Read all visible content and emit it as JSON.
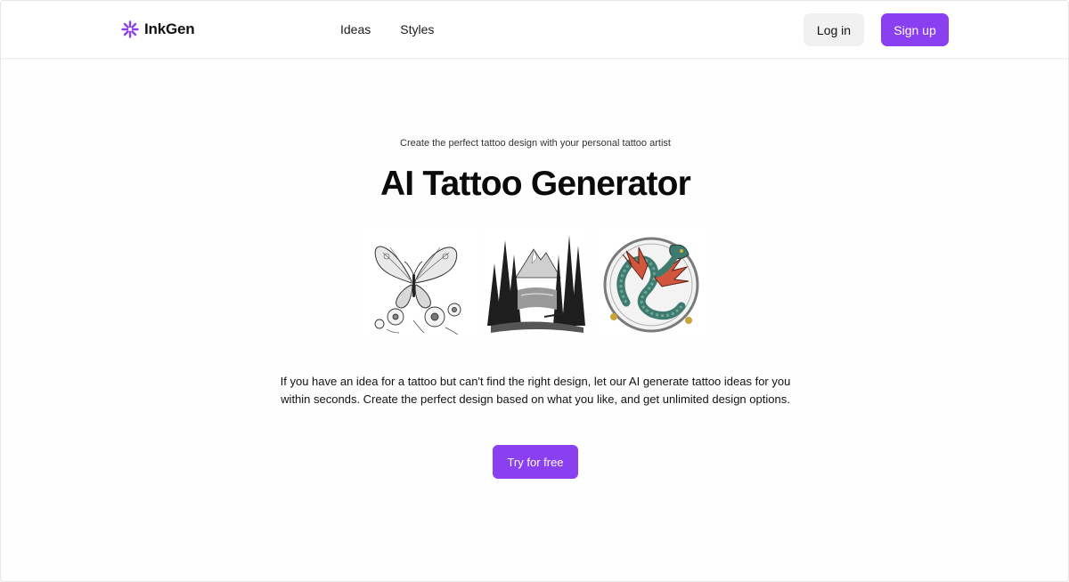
{
  "brand": {
    "name": "InkGen",
    "icon": "sparkle-logo-icon",
    "color": "#8a3ff0"
  },
  "nav": {
    "items": [
      {
        "label": "Ideas"
      },
      {
        "label": "Styles"
      }
    ]
  },
  "header": {
    "login_label": "Log in",
    "signup_label": "Sign up"
  },
  "hero": {
    "tagline": "Create the perfect tattoo design with your personal tattoo artist",
    "title": "AI Tattoo Generator",
    "images": [
      {
        "name": "butterfly-flowers-tattoo-image"
      },
      {
        "name": "forest-mountain-tattoo-image"
      },
      {
        "name": "dragon-circle-tattoo-image"
      }
    ],
    "description": "If you have an idea for a tattoo but can't find the right design, let our AI generate tattoo ideas for you within seconds. Create the perfect design based on what you like, and get unlimited design options.",
    "cta_label": "Try for free"
  },
  "colors": {
    "accent": "#8a3ff0",
    "login_bg": "#f1f1f2",
    "text": "#111111"
  }
}
